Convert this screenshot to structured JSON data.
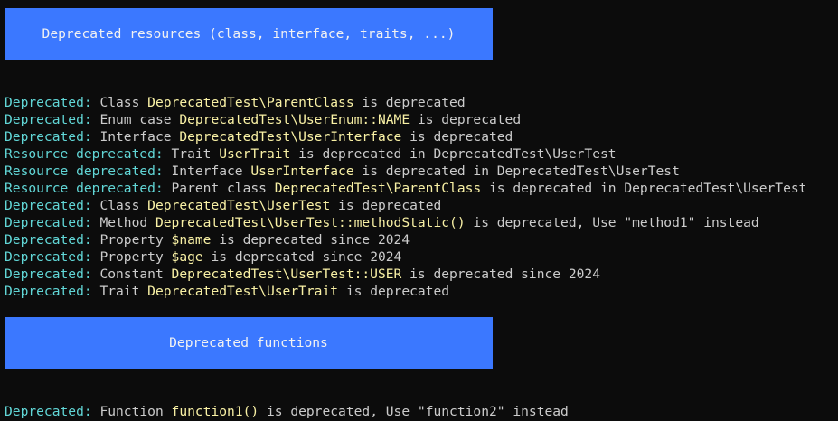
{
  "banners": {
    "resources": "Deprecated resources (class, interface, traits, ...)",
    "functions": "Deprecated functions"
  },
  "resource_lines": [
    [
      {
        "t": "tag",
        "v": "Deprecated:"
      },
      {
        "t": "txt",
        "v": " Class "
      },
      {
        "t": "hl",
        "v": "DeprecatedTest\\ParentClass"
      },
      {
        "t": "txt",
        "v": " is deprecated"
      }
    ],
    [
      {
        "t": "tag",
        "v": "Deprecated:"
      },
      {
        "t": "txt",
        "v": " Enum case "
      },
      {
        "t": "hl",
        "v": "DeprecatedTest\\UserEnum::NAME"
      },
      {
        "t": "txt",
        "v": " is deprecated"
      }
    ],
    [
      {
        "t": "tag",
        "v": "Deprecated:"
      },
      {
        "t": "txt",
        "v": " Interface "
      },
      {
        "t": "hl",
        "v": "DeprecatedTest\\UserInterface"
      },
      {
        "t": "txt",
        "v": " is deprecated"
      }
    ],
    [
      {
        "t": "tag",
        "v": "Resource deprecated:"
      },
      {
        "t": "txt",
        "v": " Trait "
      },
      {
        "t": "hl",
        "v": "UserTrait"
      },
      {
        "t": "txt",
        "v": " is deprecated in DeprecatedTest\\UserTest"
      }
    ],
    [
      {
        "t": "tag",
        "v": "Resource deprecated:"
      },
      {
        "t": "txt",
        "v": " Interface "
      },
      {
        "t": "hl",
        "v": "UserInterface"
      },
      {
        "t": "txt",
        "v": " is deprecated in DeprecatedTest\\UserTest"
      }
    ],
    [
      {
        "t": "tag",
        "v": "Resource deprecated:"
      },
      {
        "t": "txt",
        "v": " Parent class "
      },
      {
        "t": "hl",
        "v": "DeprecatedTest\\ParentClass"
      },
      {
        "t": "txt",
        "v": " is deprecated in DeprecatedTest\\UserTest"
      }
    ],
    [
      {
        "t": "tag",
        "v": "Deprecated:"
      },
      {
        "t": "txt",
        "v": " Class "
      },
      {
        "t": "hl",
        "v": "DeprecatedTest\\UserTest"
      },
      {
        "t": "txt",
        "v": " is deprecated"
      }
    ],
    [
      {
        "t": "tag",
        "v": "Deprecated:"
      },
      {
        "t": "txt",
        "v": " Method "
      },
      {
        "t": "hl",
        "v": "DeprecatedTest\\UserTest::methodStatic()"
      },
      {
        "t": "txt",
        "v": " is deprecated, Use \"method1\" instead"
      }
    ],
    [
      {
        "t": "tag",
        "v": "Deprecated:"
      },
      {
        "t": "txt",
        "v": " Property "
      },
      {
        "t": "hl",
        "v": "$name"
      },
      {
        "t": "txt",
        "v": " is deprecated since 2024"
      }
    ],
    [
      {
        "t": "tag",
        "v": "Deprecated:"
      },
      {
        "t": "txt",
        "v": " Property "
      },
      {
        "t": "hl",
        "v": "$age"
      },
      {
        "t": "txt",
        "v": " is deprecated since 2024"
      }
    ],
    [
      {
        "t": "tag",
        "v": "Deprecated:"
      },
      {
        "t": "txt",
        "v": " Constant "
      },
      {
        "t": "hl",
        "v": "DeprecatedTest\\UserTest::USER"
      },
      {
        "t": "txt",
        "v": " is deprecated since 2024"
      }
    ],
    [
      {
        "t": "tag",
        "v": "Deprecated:"
      },
      {
        "t": "txt",
        "v": " Trait "
      },
      {
        "t": "hl",
        "v": "DeprecatedTest\\UserTrait"
      },
      {
        "t": "txt",
        "v": " is deprecated"
      }
    ]
  ],
  "function_lines": [
    [
      {
        "t": "tag",
        "v": "Deprecated:"
      },
      {
        "t": "txt",
        "v": " Function "
      },
      {
        "t": "hl",
        "v": "function1()"
      },
      {
        "t": "txt",
        "v": " is deprecated, Use \"function2\" instead"
      }
    ]
  ]
}
